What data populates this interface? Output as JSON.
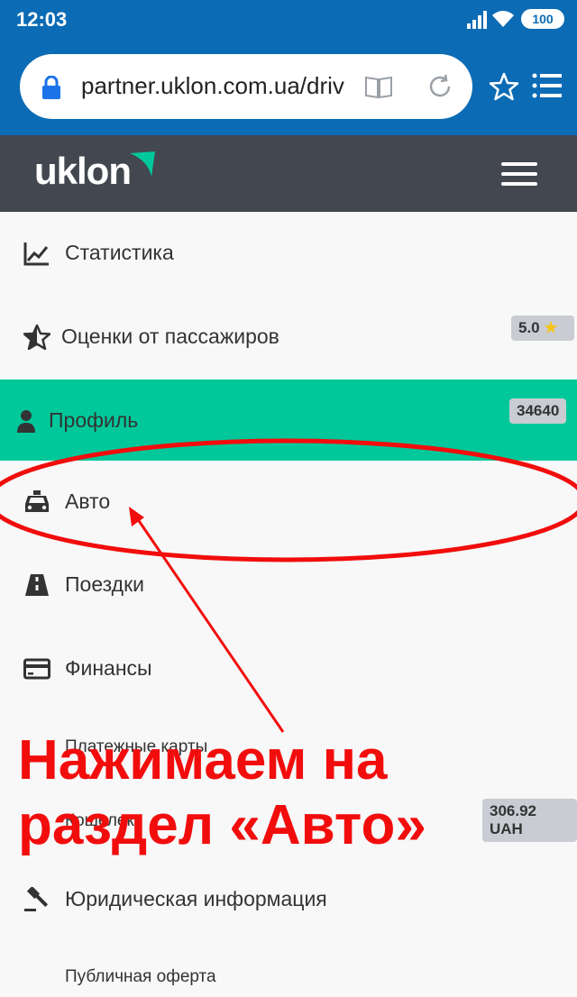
{
  "status_bar": {
    "time": "12:03",
    "battery": "100"
  },
  "browser": {
    "url": "partner.uklon.com.ua/driv"
  },
  "header": {
    "logo": "uklon"
  },
  "menu": {
    "items": [
      {
        "label": "Статистика"
      },
      {
        "label": "Оценки от пассажиров",
        "badge": "5.0"
      },
      {
        "label": "Профиль",
        "badge": "34640",
        "active": true
      },
      {
        "label": "Авто"
      },
      {
        "label": "Поездки"
      },
      {
        "label": "Финансы"
      },
      {
        "label": "Платежные карты",
        "sub": true
      },
      {
        "label": "Кошелек",
        "sub": true,
        "badge": "306.92 UAH"
      },
      {
        "label": "Юридическая информация"
      },
      {
        "label": "Публичная оферта",
        "sub": true
      }
    ]
  },
  "annotation": {
    "line1": "Нажимаем на",
    "line2": "раздел «Авто»"
  },
  "colors": {
    "browser_bar": "#0b6bb4",
    "app_header": "#424750",
    "active_item": "#00c89b",
    "annotation": "#f20d0d"
  }
}
